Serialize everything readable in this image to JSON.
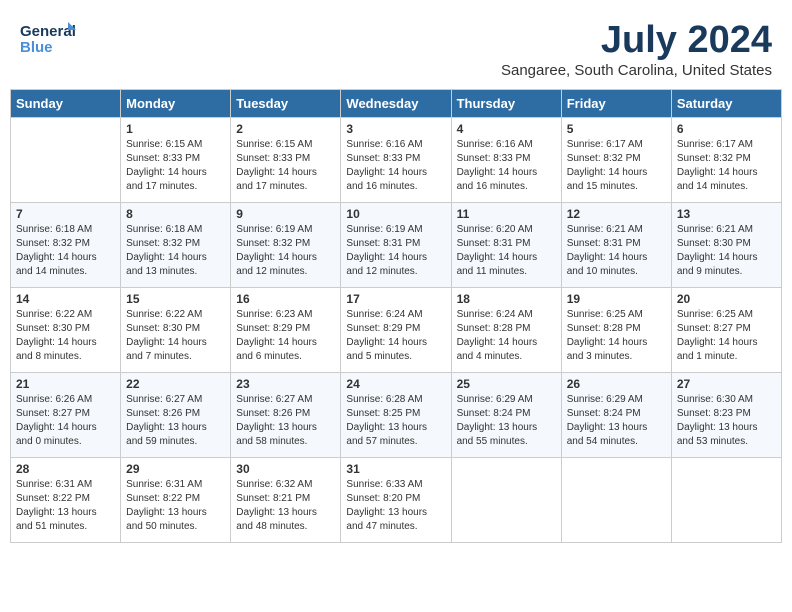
{
  "logo": {
    "line1": "General",
    "line2": "Blue"
  },
  "title": {
    "month_year": "July 2024",
    "location": "Sangaree, South Carolina, United States"
  },
  "weekdays": [
    "Sunday",
    "Monday",
    "Tuesday",
    "Wednesday",
    "Thursday",
    "Friday",
    "Saturday"
  ],
  "weeks": [
    [
      {
        "day": "",
        "info": ""
      },
      {
        "day": "1",
        "info": "Sunrise: 6:15 AM\nSunset: 8:33 PM\nDaylight: 14 hours\nand 17 minutes."
      },
      {
        "day": "2",
        "info": "Sunrise: 6:15 AM\nSunset: 8:33 PM\nDaylight: 14 hours\nand 17 minutes."
      },
      {
        "day": "3",
        "info": "Sunrise: 6:16 AM\nSunset: 8:33 PM\nDaylight: 14 hours\nand 16 minutes."
      },
      {
        "day": "4",
        "info": "Sunrise: 6:16 AM\nSunset: 8:33 PM\nDaylight: 14 hours\nand 16 minutes."
      },
      {
        "day": "5",
        "info": "Sunrise: 6:17 AM\nSunset: 8:32 PM\nDaylight: 14 hours\nand 15 minutes."
      },
      {
        "day": "6",
        "info": "Sunrise: 6:17 AM\nSunset: 8:32 PM\nDaylight: 14 hours\nand 14 minutes."
      }
    ],
    [
      {
        "day": "7",
        "info": "Sunrise: 6:18 AM\nSunset: 8:32 PM\nDaylight: 14 hours\nand 14 minutes."
      },
      {
        "day": "8",
        "info": "Sunrise: 6:18 AM\nSunset: 8:32 PM\nDaylight: 14 hours\nand 13 minutes."
      },
      {
        "day": "9",
        "info": "Sunrise: 6:19 AM\nSunset: 8:32 PM\nDaylight: 14 hours\nand 12 minutes."
      },
      {
        "day": "10",
        "info": "Sunrise: 6:19 AM\nSunset: 8:31 PM\nDaylight: 14 hours\nand 12 minutes."
      },
      {
        "day": "11",
        "info": "Sunrise: 6:20 AM\nSunset: 8:31 PM\nDaylight: 14 hours\nand 11 minutes."
      },
      {
        "day": "12",
        "info": "Sunrise: 6:21 AM\nSunset: 8:31 PM\nDaylight: 14 hours\nand 10 minutes."
      },
      {
        "day": "13",
        "info": "Sunrise: 6:21 AM\nSunset: 8:30 PM\nDaylight: 14 hours\nand 9 minutes."
      }
    ],
    [
      {
        "day": "14",
        "info": "Sunrise: 6:22 AM\nSunset: 8:30 PM\nDaylight: 14 hours\nand 8 minutes."
      },
      {
        "day": "15",
        "info": "Sunrise: 6:22 AM\nSunset: 8:30 PM\nDaylight: 14 hours\nand 7 minutes."
      },
      {
        "day": "16",
        "info": "Sunrise: 6:23 AM\nSunset: 8:29 PM\nDaylight: 14 hours\nand 6 minutes."
      },
      {
        "day": "17",
        "info": "Sunrise: 6:24 AM\nSunset: 8:29 PM\nDaylight: 14 hours\nand 5 minutes."
      },
      {
        "day": "18",
        "info": "Sunrise: 6:24 AM\nSunset: 8:28 PM\nDaylight: 14 hours\nand 4 minutes."
      },
      {
        "day": "19",
        "info": "Sunrise: 6:25 AM\nSunset: 8:28 PM\nDaylight: 14 hours\nand 3 minutes."
      },
      {
        "day": "20",
        "info": "Sunrise: 6:25 AM\nSunset: 8:27 PM\nDaylight: 14 hours\nand 1 minute."
      }
    ],
    [
      {
        "day": "21",
        "info": "Sunrise: 6:26 AM\nSunset: 8:27 PM\nDaylight: 14 hours\nand 0 minutes."
      },
      {
        "day": "22",
        "info": "Sunrise: 6:27 AM\nSunset: 8:26 PM\nDaylight: 13 hours\nand 59 minutes."
      },
      {
        "day": "23",
        "info": "Sunrise: 6:27 AM\nSunset: 8:26 PM\nDaylight: 13 hours\nand 58 minutes."
      },
      {
        "day": "24",
        "info": "Sunrise: 6:28 AM\nSunset: 8:25 PM\nDaylight: 13 hours\nand 57 minutes."
      },
      {
        "day": "25",
        "info": "Sunrise: 6:29 AM\nSunset: 8:24 PM\nDaylight: 13 hours\nand 55 minutes."
      },
      {
        "day": "26",
        "info": "Sunrise: 6:29 AM\nSunset: 8:24 PM\nDaylight: 13 hours\nand 54 minutes."
      },
      {
        "day": "27",
        "info": "Sunrise: 6:30 AM\nSunset: 8:23 PM\nDaylight: 13 hours\nand 53 minutes."
      }
    ],
    [
      {
        "day": "28",
        "info": "Sunrise: 6:31 AM\nSunset: 8:22 PM\nDaylight: 13 hours\nand 51 minutes."
      },
      {
        "day": "29",
        "info": "Sunrise: 6:31 AM\nSunset: 8:22 PM\nDaylight: 13 hours\nand 50 minutes."
      },
      {
        "day": "30",
        "info": "Sunrise: 6:32 AM\nSunset: 8:21 PM\nDaylight: 13 hours\nand 48 minutes."
      },
      {
        "day": "31",
        "info": "Sunrise: 6:33 AM\nSunset: 8:20 PM\nDaylight: 13 hours\nand 47 minutes."
      },
      {
        "day": "",
        "info": ""
      },
      {
        "day": "",
        "info": ""
      },
      {
        "day": "",
        "info": ""
      }
    ]
  ]
}
